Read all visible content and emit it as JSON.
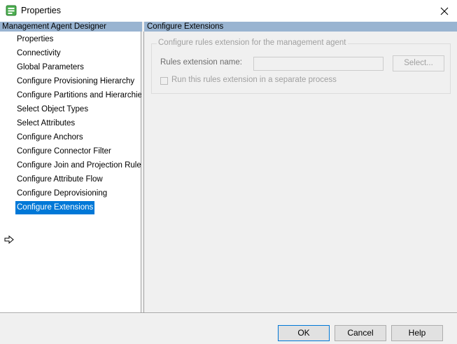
{
  "window": {
    "title": "Properties",
    "close_glyph": "✕",
    "icon": "properties-app-icon"
  },
  "left_panel": {
    "header": "Management Agent Designer",
    "items": [
      {
        "label": "Properties"
      },
      {
        "label": "Connectivity"
      },
      {
        "label": "Global Parameters"
      },
      {
        "label": "Configure Provisioning Hierarchy"
      },
      {
        "label": "Configure Partitions and Hierarchies"
      },
      {
        "label": "Select Object Types"
      },
      {
        "label": "Select Attributes"
      },
      {
        "label": "Configure Anchors"
      },
      {
        "label": "Configure Connector Filter"
      },
      {
        "label": "Configure Join and Projection Rules"
      },
      {
        "label": "Configure Attribute Flow"
      },
      {
        "label": "Configure Deprovisioning"
      },
      {
        "label": "Configure Extensions"
      }
    ],
    "selected_index": 12,
    "selection_color": "#0078d7"
  },
  "right_panel": {
    "header": "Configure Extensions",
    "group_title": "Configure rules extension for the management agent",
    "field_label": "Rules extension name:",
    "field_value": "",
    "select_button": "Select...",
    "checkbox_label": "Run this rules extension in a separate process",
    "checkbox_checked": false
  },
  "buttons": {
    "ok": "OK",
    "cancel": "Cancel",
    "help": "Help"
  },
  "colors": {
    "header_bg": "#99b4d1",
    "panel_bg": "#f0f0f0"
  }
}
